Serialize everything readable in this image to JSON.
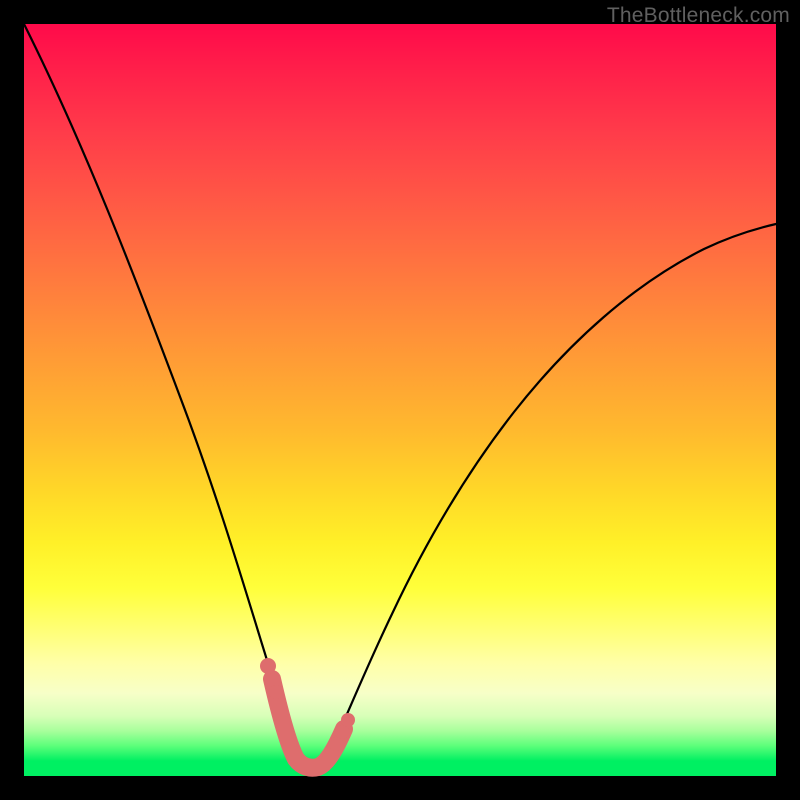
{
  "watermark": "TheBottleneck.com",
  "colors": {
    "overlay": "#de6d6d",
    "curve": "#000000",
    "bg_top": "#ff0a4a",
    "bg_bottom": "#00f062"
  },
  "chart_data": {
    "type": "line",
    "title": "",
    "xlabel": "",
    "ylabel": "",
    "xlim": [
      0,
      100
    ],
    "ylim": [
      0,
      100
    ],
    "grid": false,
    "legend": null,
    "series": [
      {
        "name": "bottleneck-curve",
        "x": [
          0,
          4,
          8,
          12,
          16,
          20,
          23,
          26,
          29,
          31,
          33,
          34.5,
          36,
          38,
          40,
          42,
          45,
          50,
          56,
          62,
          70,
          80,
          90,
          100
        ],
        "y": [
          100,
          87,
          74,
          61,
          49,
          37,
          28,
          20,
          13,
          8,
          4,
          2,
          1,
          2,
          4,
          7,
          11,
          19,
          28,
          36,
          45,
          55,
          63,
          70
        ]
      }
    ],
    "highlight": {
      "name": "optimal-range",
      "x_range": [
        30,
        41
      ],
      "dots_x": [
        30.2,
        31.5,
        39.0,
        40.0,
        41.0
      ],
      "note": "thick coral band around curve minimum"
    },
    "background_gradient_meaning": "vertical position maps to bottleneck severity (top=red=high, bottom=green=low)"
  }
}
